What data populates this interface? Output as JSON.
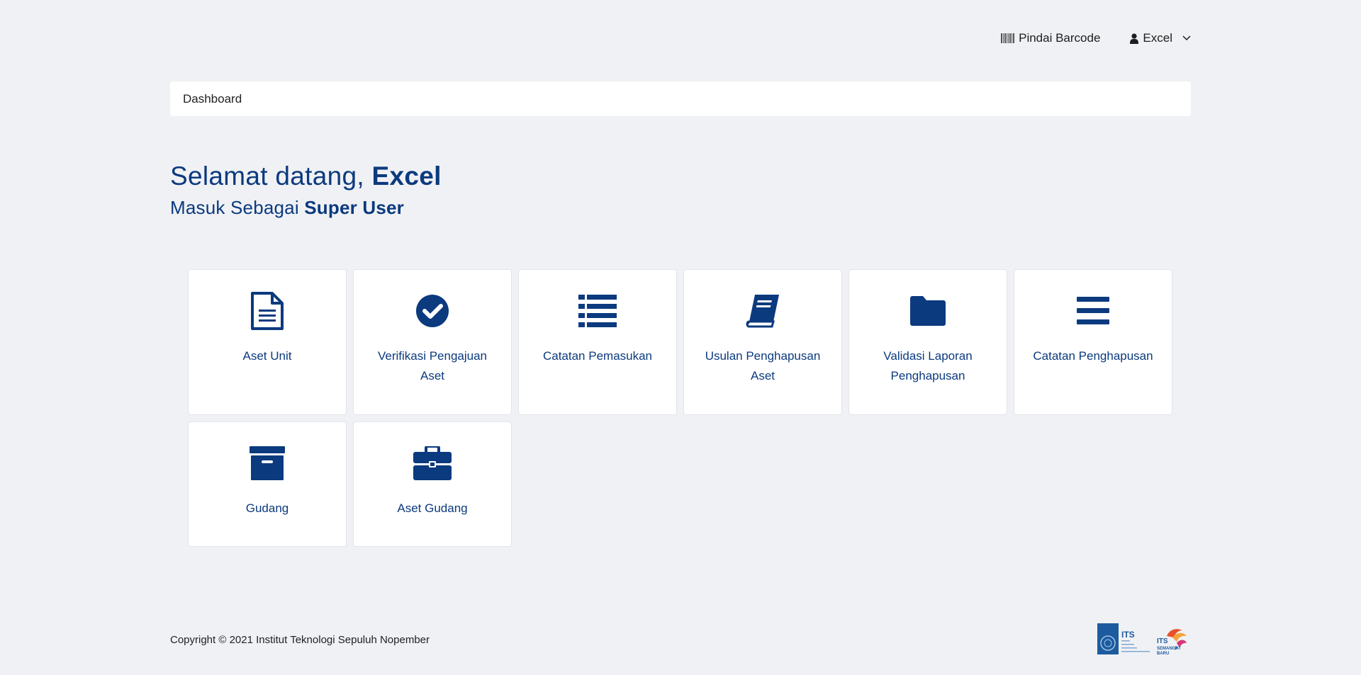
{
  "nav": {
    "barcode_label": "Pindai Barcode",
    "user_label": "Excel"
  },
  "breadcrumb": {
    "label": "Dashboard"
  },
  "welcome": {
    "greeting_prefix": "Selamat datang, ",
    "user_name": "Excel",
    "role_prefix": "Masuk Sebagai ",
    "role": "Super User"
  },
  "cards": [
    {
      "label": "Aset Unit",
      "icon": "file-document-icon"
    },
    {
      "label": "Verifikasi Pengajuan Aset",
      "icon": "check-circle-icon"
    },
    {
      "label": "Catatan Pemasukan",
      "icon": "list-icon"
    },
    {
      "label": "Usulan Penghapusan Aset",
      "icon": "book-icon"
    },
    {
      "label": "Validasi Laporan Penghapusan",
      "icon": "folder-icon"
    },
    {
      "label": "Catatan Penghapusan",
      "icon": "bars-icon"
    },
    {
      "label": "Gudang",
      "icon": "archive-box-icon"
    },
    {
      "label": "Aset Gudang",
      "icon": "briefcase-icon"
    }
  ],
  "footer": {
    "copyright": "Copyright © 2021 Institut Teknologi Sepuluh Nopember",
    "logo_its_text": "ITS",
    "logo_its_subtext": "Institut Teknologi Sepuluh Nopember",
    "logo_semangat_text": "ITS SEMANGAT BARU"
  },
  "colors": {
    "primary": "#0b3a7e",
    "background": "#f0f1f5"
  }
}
